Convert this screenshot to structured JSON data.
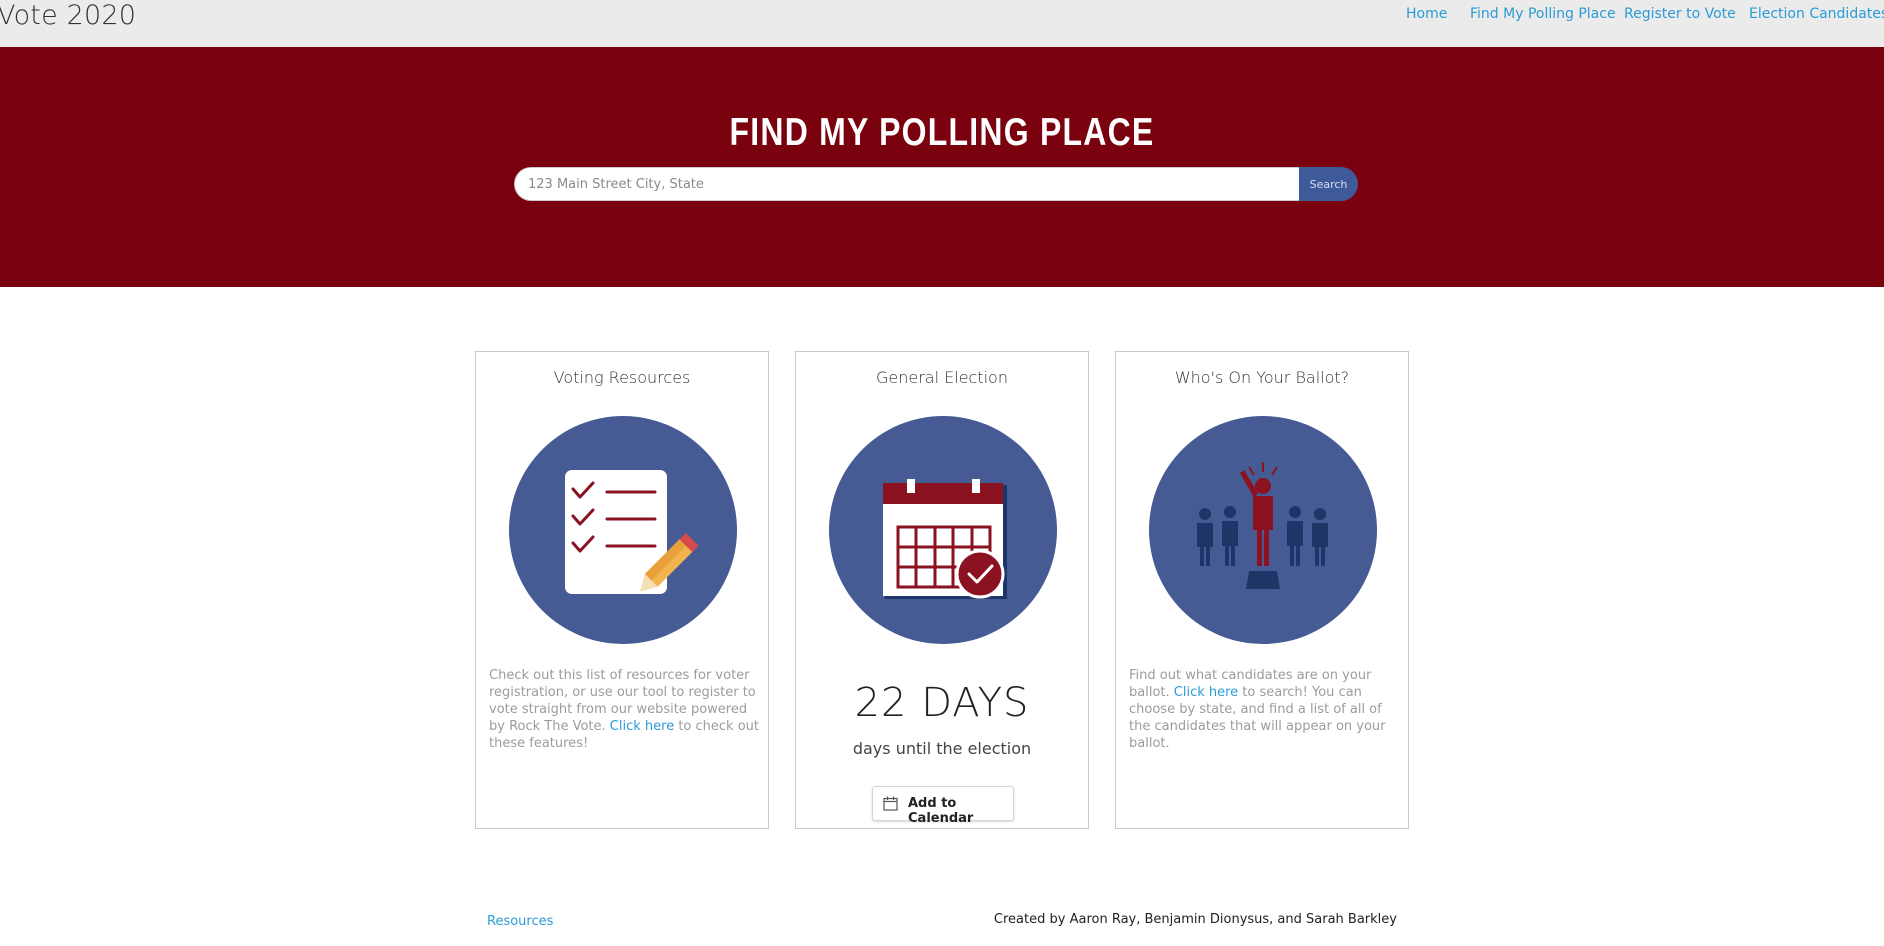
{
  "nav": {
    "brand": "Vote 2020",
    "links": [
      "Home",
      "Find My Polling Place",
      "Register to Vote",
      "Election Candidates"
    ]
  },
  "hero": {
    "title": "FIND MY POLLING PLACE",
    "search_placeholder": "123 Main Street City, State",
    "search_button": "Search"
  },
  "cards": {
    "resources": {
      "title": "Voting Resources",
      "icon": "checklist-icon",
      "text_before": "Check out this list of resources for voter registration, or use our tool to register to vote straight from our website powered by Rock The Vote. ",
      "link": "Click here",
      "text_after": " to check out these features!"
    },
    "election": {
      "title": "General Election",
      "icon": "calendar-check-icon",
      "days": "22 DAYS",
      "days_label": "days until the election",
      "calendar_button": "Add to Calendar"
    },
    "ballot": {
      "title": "Who's On Your Ballot?",
      "icon": "candidate-crowd-icon",
      "text_before": "Find out what candidates are on your ballot. ",
      "link": "Click here",
      "text_after": " to search! You can choose by state, and find a list of all of the candidates that will appear on your ballot."
    }
  },
  "footer": {
    "resources_link": "Resources",
    "credits": "Created by Aaron Ray, Benjamin Dionysus, and Sarah Barkley"
  },
  "colors": {
    "hero_bg": "#7a020f",
    "accent_blue": "#465b94",
    "link": "#2b9bd6",
    "icon_red": "#8b1220"
  }
}
